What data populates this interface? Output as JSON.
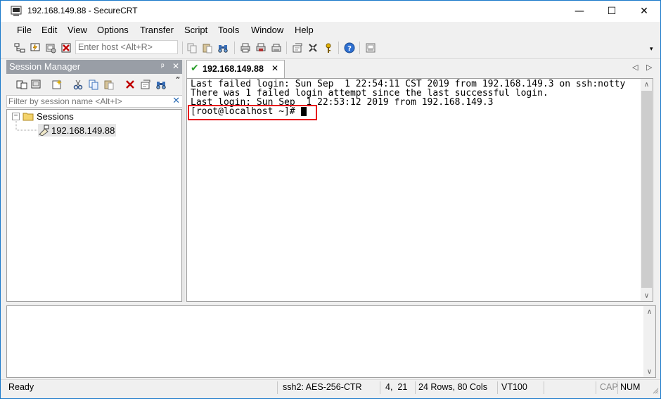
{
  "window": {
    "title": "192.168.149.88 - SecureCRT",
    "controls": {
      "minimize": "—",
      "maximize": "☐",
      "close": "✕"
    }
  },
  "menu": [
    "File",
    "Edit",
    "View",
    "Options",
    "Transfer",
    "Script",
    "Tools",
    "Window",
    "Help"
  ],
  "toolbar": {
    "host_placeholder": "Enter host <Alt+R>",
    "icons": [
      "connect-icon",
      "quick-connect-icon",
      "connect-in-tab-icon",
      "disconnect-icon",
      "copy-icon",
      "paste-icon",
      "find-icon",
      "print-icon",
      "print-selection-icon",
      "printer-setup-icon",
      "session-options-icon",
      "global-options-icon",
      "keymap-icon",
      "help-icon",
      "sftp-icon"
    ]
  },
  "session_manager": {
    "title": "Session Manager",
    "pin": "ᵖ",
    "close": "✕",
    "more": "”",
    "filter_placeholder": "Filter by session name <Alt+I>",
    "filter_clear": "✕",
    "tree": {
      "toggle": "−",
      "root": "Sessions",
      "children": [
        "192.168.149.88"
      ]
    }
  },
  "tab": {
    "check": "✔",
    "label": "192.168.149.88",
    "close": "✕",
    "nav_left": "◁",
    "nav_right": "▷"
  },
  "terminal": {
    "lines": [
      "Last failed login: Sun Sep  1 22:54:11 CST 2019 from 192.168.149.3 on ssh:notty",
      "There was 1 failed login attempt since the last successful login.",
      "Last login: Sun Sep  1 22:53:12 2019 from 192.168.149.3"
    ],
    "prompt": "[root@localhost ~]# "
  },
  "scroll": {
    "up": "∧",
    "down": "∨"
  },
  "status": {
    "ready": "Ready",
    "cipher": "ssh2: AES-256-CTR",
    "position": "4,  21",
    "size": "24 Rows, 80 Cols",
    "emulation": "VT100",
    "cap": "CAP",
    "num": "NUM"
  },
  "colors": {
    "window_border": "#1979ca",
    "panel_header": "#999ea6",
    "highlight_box": "#e8131c",
    "tab_check": "#2ca02c"
  }
}
